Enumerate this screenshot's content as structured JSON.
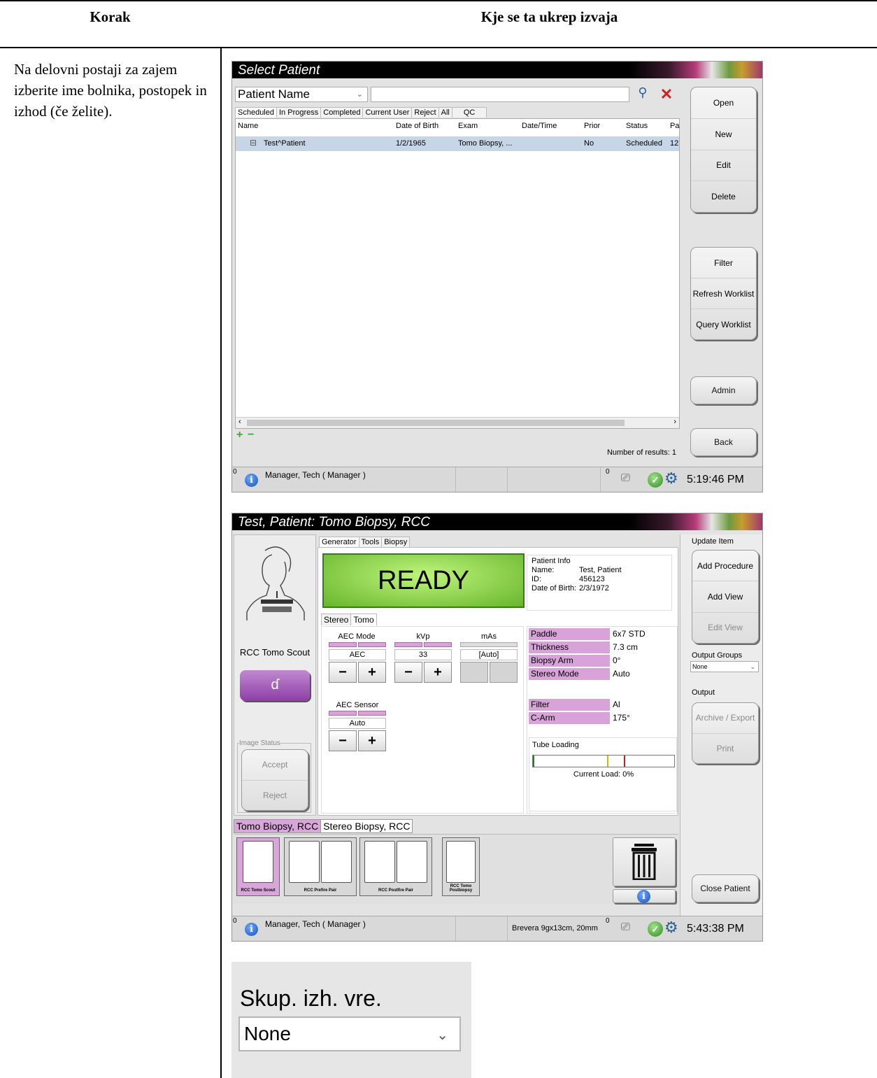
{
  "table_header": {
    "col_step": "Korak",
    "col_where": "Kje se ta ukrep izvaja"
  },
  "step_text": "Na delovni postaji za zajem izberite ime bolnika, postopek in izhod (če želite).",
  "select_patient": {
    "title": "Select Patient",
    "search_field_label": "Patient Name",
    "search_value": "",
    "tabs": [
      "Scheduled",
      "In Progress",
      "Completed",
      "Current User",
      "Reject",
      "All",
      "QC"
    ],
    "columns": [
      "Name",
      "Date of Birth",
      "Exam",
      "Date/Time",
      "Prior",
      "Status",
      "Pa"
    ],
    "rows": [
      {
        "name": "Test^Patient",
        "dob": "1/2/1965",
        "exam": "Tomo Biopsy, ...",
        "datetime": "",
        "prior": "No",
        "status": "Scheduled",
        "pa": "12"
      }
    ],
    "results": "Number of results: 1",
    "buttons": {
      "open": "Open",
      "new": "New",
      "edit": "Edit",
      "delete": "Delete",
      "filter": "Filter",
      "refresh": "Refresh Worklist",
      "query": "Query Worklist",
      "admin": "Admin",
      "back": "Back"
    },
    "status": {
      "count_left": "0",
      "user": "Manager, Tech ( Manager )",
      "count_right": "0",
      "time": "5:19:46 PM"
    }
  },
  "procedure": {
    "title": "Test, Patient:  Tomo Biopsy, RCC",
    "top_tabs": [
      "Generator",
      "Tools",
      "Biopsy"
    ],
    "ready": "READY",
    "patient_info": {
      "heading": "Patient Info",
      "name_label": "Name:",
      "name": "Test, Patient",
      "id_label": "ID:",
      "id": "456123",
      "dob_label": "Date of Birth:",
      "dob": "2/3/1972"
    },
    "view_label": "RCC Tomo Scout",
    "mode_tabs": [
      "Stereo",
      "Tomo"
    ],
    "aec_mode": {
      "label": "AEC Mode",
      "value": "AEC"
    },
    "kvp": {
      "label": "kVp",
      "value": "33"
    },
    "mas": {
      "label": "mAs",
      "value": "[Auto]"
    },
    "aec_sensor": {
      "label": "AEC Sensor",
      "value": "Auto"
    },
    "plus": "+",
    "minus": "−",
    "fields": [
      {
        "label": "Paddle",
        "value": "6x7 STD"
      },
      {
        "label": "Thickness",
        "value": "7.3 cm"
      },
      {
        "label": "Biopsy Arm",
        "value": "0°"
      },
      {
        "label": "Stereo Mode",
        "value": "Auto"
      },
      {
        "label": "Filter",
        "value": "Al"
      },
      {
        "label": "C-Arm",
        "value": "175°"
      }
    ],
    "tube_loading": {
      "label": "Tube Loading",
      "current": "Current Load: 0%",
      "load_fraction": 0
    },
    "image_status": {
      "label": "Image Status",
      "accept": "Accept",
      "reject": "Reject"
    },
    "bottom_tabs": [
      "Tomo Biopsy, RCC",
      "Stereo Biopsy, RCC"
    ],
    "thumbs": [
      "RCC Tomo Scout",
      "RCC Prefire Pair",
      "RCC Postfire Pair",
      "RCC Tomo Postbiopsy"
    ],
    "right": {
      "update_item": "Update Item",
      "add_procedure": "Add Procedure",
      "add_view": "Add View",
      "edit_view": "Edit View",
      "output_groups": "Output Groups",
      "output_value": "None",
      "output": "Output",
      "archive": "Archive / Export",
      "print": "Print",
      "close": "Close Patient"
    },
    "status": {
      "count_left": "0",
      "user": "Manager, Tech ( Manager )",
      "device": "Brevera 9gx13cm, 20mm",
      "count_right": "0",
      "time": "5:43:38 PM"
    }
  },
  "zoom": {
    "label": "Skup. izh. vre.",
    "value": "None"
  }
}
